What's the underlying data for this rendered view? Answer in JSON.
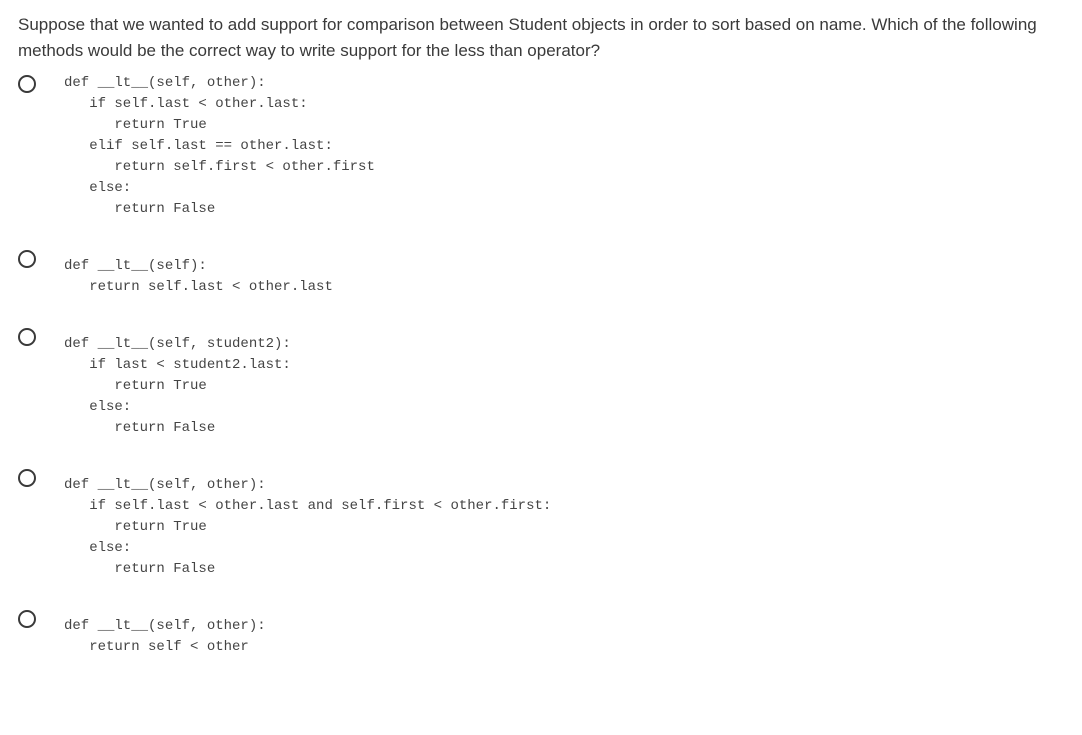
{
  "question": "Suppose that we wanted to add support for comparison between Student objects in order to sort based on name. Which of the following methods would be the correct way to write support for the less than operator?",
  "options": [
    {
      "code": "def __lt__(self, other):\n   if self.last < other.last:\n      return True\n   elif self.last == other.last:\n      return self.first < other.first\n   else:\n      return False"
    },
    {
      "code": "def __lt__(self):\n   return self.last < other.last"
    },
    {
      "code": "def __lt__(self, student2):\n   if last < student2.last:\n      return True\n   else:\n      return False"
    },
    {
      "code": "def __lt__(self, other):\n   if self.last < other.last and self.first < other.first:\n      return True\n   else:\n      return False"
    },
    {
      "code": "def __lt__(self, other):\n   return self < other"
    }
  ]
}
